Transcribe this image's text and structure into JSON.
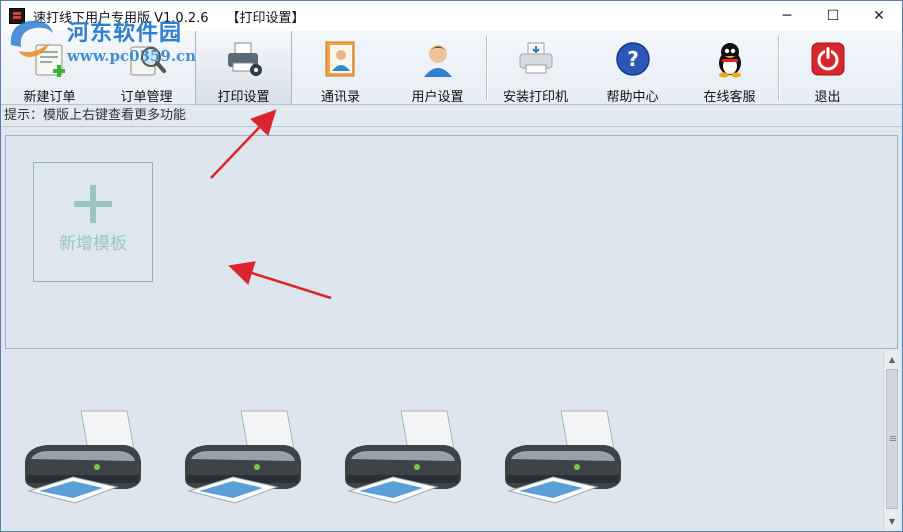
{
  "titlebar": {
    "title": "速打线下用户专用版 V1.0.2.6",
    "subtitle": "【打印设置】",
    "minimize": "─",
    "maximize": "☐",
    "close": "✕"
  },
  "watermark": {
    "line1": "河东软件园",
    "line2": "www.pc0359.cn"
  },
  "toolbar": {
    "items": [
      {
        "label": "新建订单",
        "icon": "new-order-icon"
      },
      {
        "label": "订单管理",
        "icon": "order-manage-icon"
      },
      {
        "label": "打印设置",
        "icon": "print-settings-icon",
        "active": true
      },
      {
        "label": "通讯录",
        "icon": "contacts-icon"
      },
      {
        "label": "用户设置",
        "icon": "user-icon"
      },
      {
        "label": "安装打印机",
        "icon": "install-printer-icon"
      },
      {
        "label": "帮助中心",
        "icon": "help-icon"
      },
      {
        "label": "在线客服",
        "icon": "qq-icon"
      },
      {
        "label": "退出",
        "icon": "power-icon"
      }
    ]
  },
  "hint": "提示：模版上右键查看更多功能",
  "templates": {
    "new_label": "新增模板"
  },
  "colors": {
    "accent_red": "#d9262c",
    "help_blue": "#2a57b8",
    "template_plus": "#9cc5c1"
  }
}
